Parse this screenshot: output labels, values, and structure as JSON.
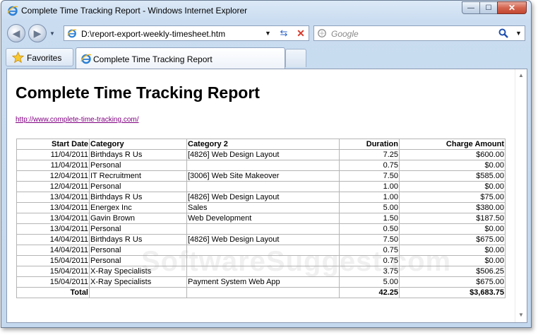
{
  "window": {
    "title": "Complete Time Tracking Report - Windows Internet Explorer",
    "buttons": {
      "minimize": "—",
      "maximize": "☐",
      "close": "✕"
    }
  },
  "toolbar": {
    "address": "D:\\report-export-weekly-timesheet.htm",
    "search_placeholder": "Google"
  },
  "tabs": {
    "favorites_label": "Favorites",
    "active_tab_label": "Complete Time Tracking Report"
  },
  "page": {
    "heading": "Complete Time Tracking Report",
    "link": "http://www.complete-time-tracking.com/",
    "watermark": "SoftwareSuggest.com"
  },
  "report": {
    "headers": [
      "Start Date",
      "Category",
      "Category 2",
      "Duration",
      "Charge Amount"
    ],
    "rows": [
      [
        "11/04/2011",
        "Birthdays R Us",
        "[4826] Web Design Layout",
        "7.25",
        "$600.00"
      ],
      [
        "11/04/2011",
        "Personal",
        "",
        "0.75",
        "$0.00"
      ],
      [
        "12/04/2011",
        "IT Recruitment",
        "[3006] Web Site Makeover",
        "7.50",
        "$585.00"
      ],
      [
        "12/04/2011",
        "Personal",
        "",
        "1.00",
        "$0.00"
      ],
      [
        "13/04/2011",
        "Birthdays R Us",
        "[4826] Web Design Layout",
        "1.00",
        "$75.00"
      ],
      [
        "13/04/2011",
        "Energex Inc",
        "Sales",
        "5.00",
        "$380.00"
      ],
      [
        "13/04/2011",
        "Gavin Brown",
        "Web Development",
        "1.50",
        "$187.50"
      ],
      [
        "13/04/2011",
        "Personal",
        "",
        "0.50",
        "$0.00"
      ],
      [
        "14/04/2011",
        "Birthdays R Us",
        "[4826] Web Design Layout",
        "7.50",
        "$675.00"
      ],
      [
        "14/04/2011",
        "Personal",
        "",
        "0.75",
        "$0.00"
      ],
      [
        "15/04/2011",
        "Personal",
        "",
        "0.75",
        "$0.00"
      ],
      [
        "15/04/2011",
        "X-Ray Specialists",
        "",
        "3.75",
        "$506.25"
      ],
      [
        "15/04/2011",
        "X-Ray Specialists",
        "Payment System Web App",
        "5.00",
        "$675.00"
      ]
    ],
    "total": {
      "label": "Total",
      "duration": "42.25",
      "charge": "$3,683.75"
    }
  },
  "colors": {
    "link_visited": "#800080",
    "close_button": "#c34730",
    "chrome": "#c9dcf0"
  },
  "icons": [
    "ie-logo-icon",
    "back-icon",
    "forward-icon",
    "page-icon",
    "refresh-icon",
    "stop-icon",
    "search-engine-icon",
    "search-icon",
    "favorites-star-icon"
  ]
}
